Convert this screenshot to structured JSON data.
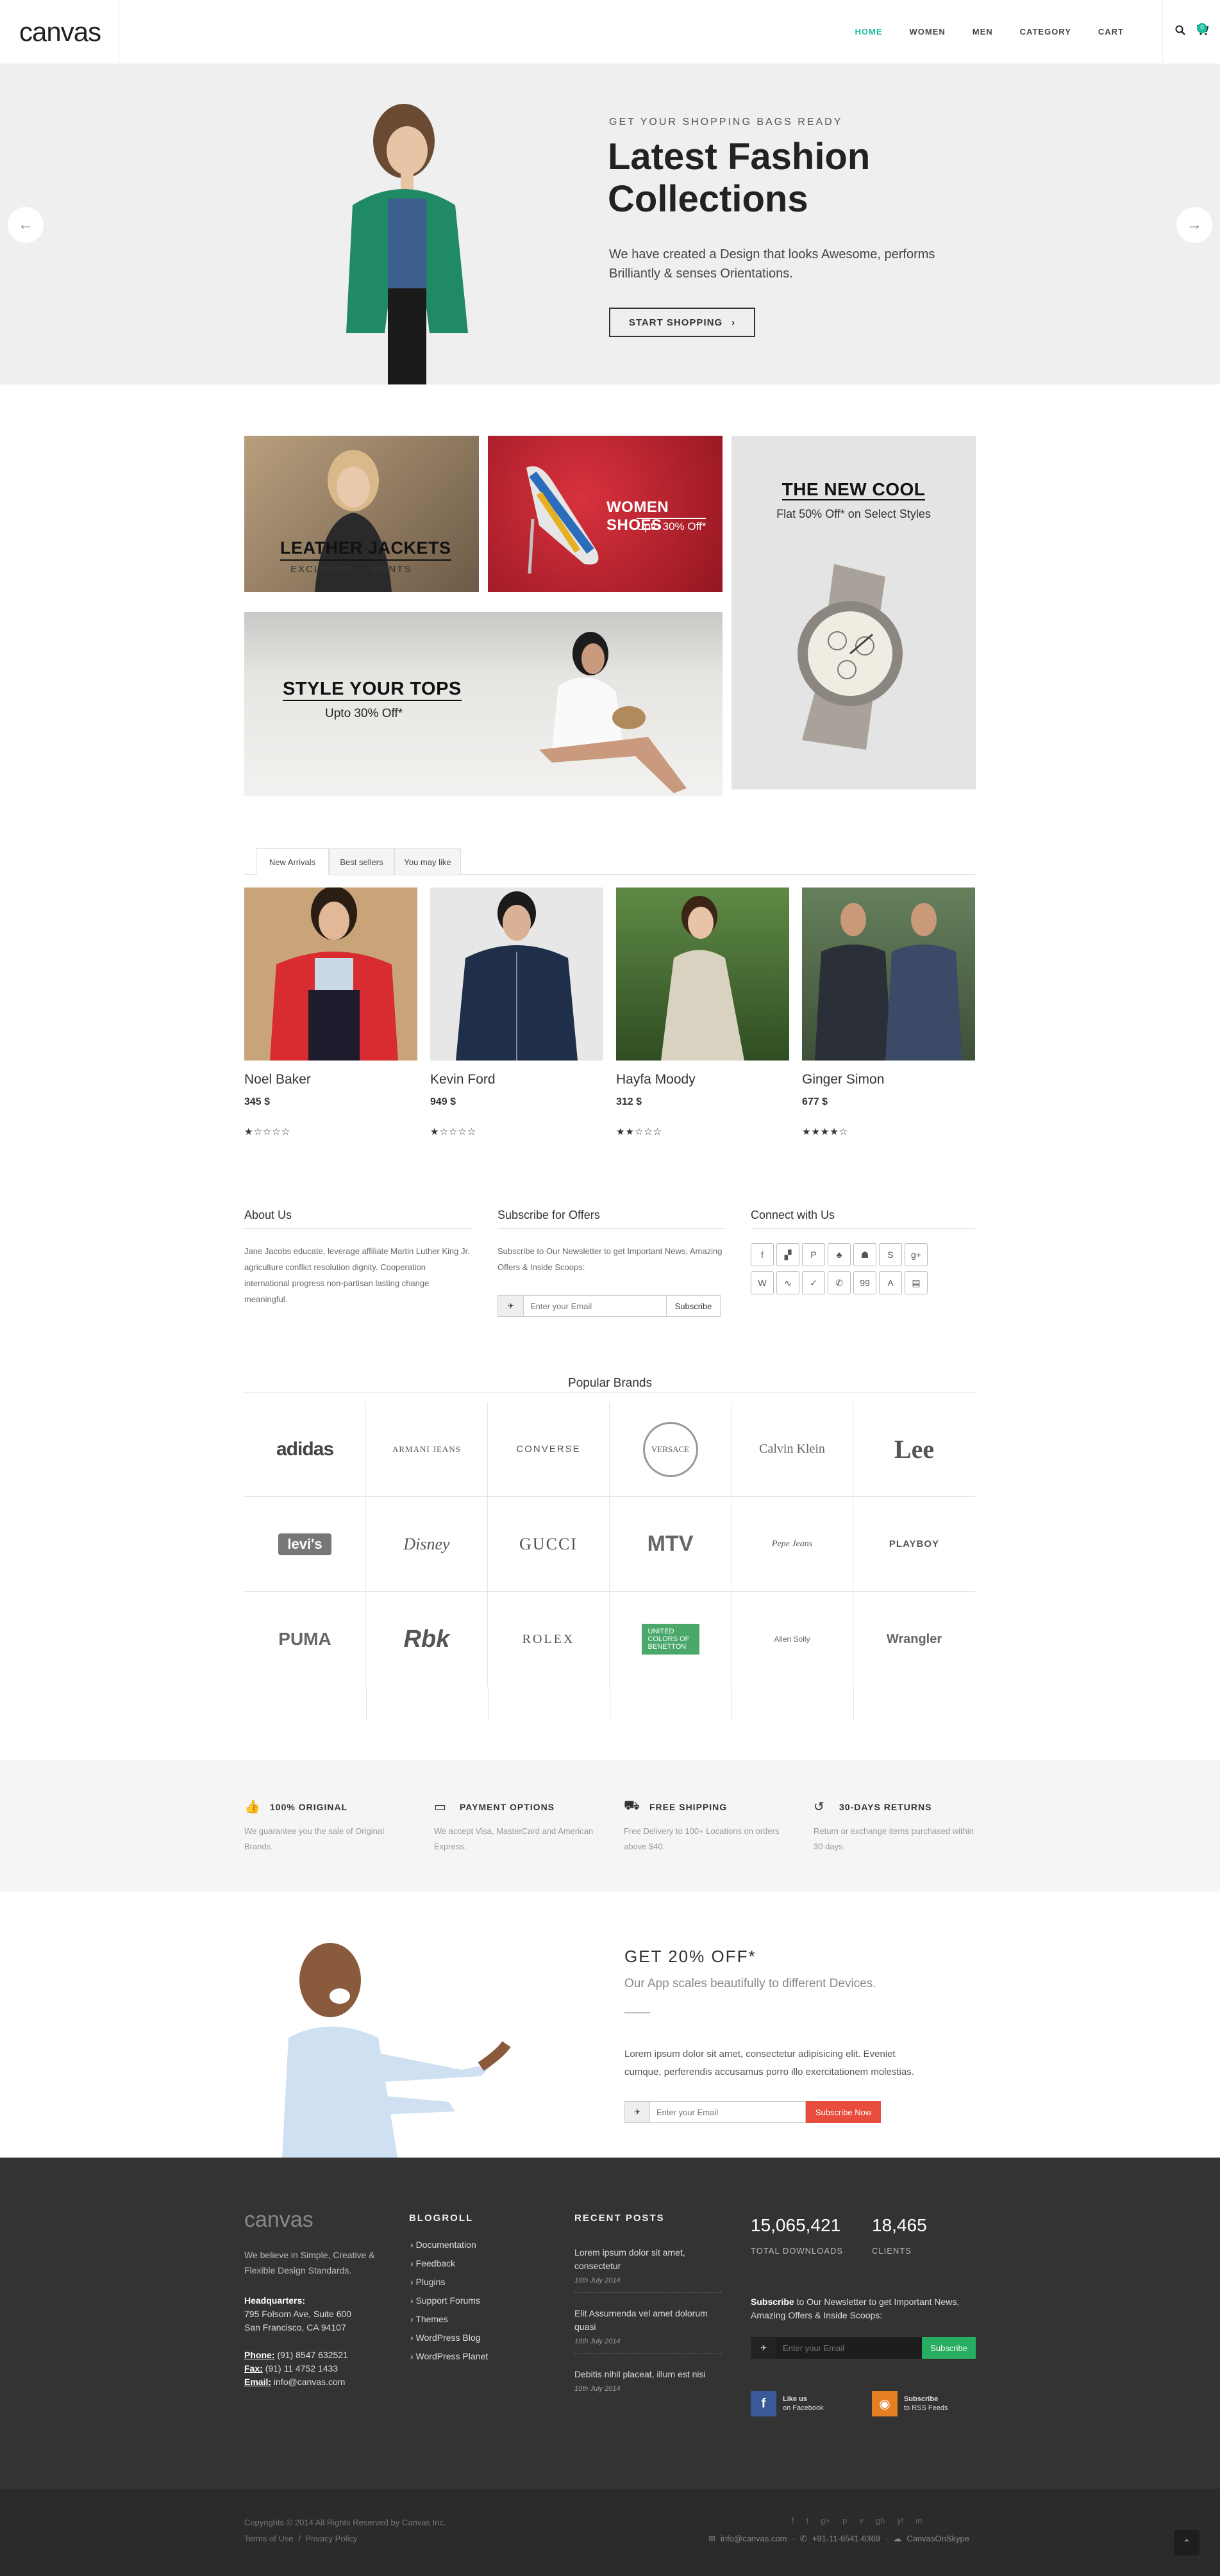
{
  "header": {
    "logo": "canvas",
    "nav": [
      "HOME",
      "WOMEN",
      "MEN",
      "CATEGORY",
      "CART"
    ],
    "cart_count": "0",
    "icons": [
      "search-icon",
      "cart-icon"
    ]
  },
  "hero": {
    "subtitle": "GET YOUR SHOPPING BAGS READY",
    "title": "Latest Fashion Collections",
    "text": "We have created a Design that looks Awesome, performs Brilliantly & senses Orientations.",
    "button": "START SHOPPING",
    "button_arrow": "›",
    "prev": "←",
    "next": "→"
  },
  "promos": {
    "leather": {
      "title": "LEATHER JACKETS",
      "sub": "EXCLUSIVE... MENTS"
    },
    "shoes": {
      "title": "WOMEN SHOES",
      "sub": "Upto 30% Off*"
    },
    "watch": {
      "title": "THE NEW COOL",
      "sub": "Flat 50% Off* on Select Styles"
    },
    "tops": {
      "title": "STYLE YOUR TOPS",
      "sub": "Upto 30% Off*"
    }
  },
  "tabs": [
    "New Arrivals",
    "Best sellers",
    "You may like"
  ],
  "products": [
    {
      "name": "Noel Baker",
      "price": "345 $",
      "rating": 1,
      "stars": "★☆☆☆☆",
      "colors": [
        "#d82b32",
        "#c8a478"
      ]
    },
    {
      "name": "Kevin Ford",
      "price": "949 $",
      "rating": 1,
      "stars": "★☆☆☆☆",
      "colors": [
        "#1f2f4a",
        "#e7e7e7"
      ]
    },
    {
      "name": "Hayfa Moody",
      "price": "312 $",
      "rating": 2,
      "stars": "★★☆☆☆",
      "colors": [
        "#d9d2c0",
        "#3d6b2d"
      ]
    },
    {
      "name": "Ginger Simon",
      "price": "677 $",
      "rating": 4,
      "stars": "★★★★☆",
      "colors": [
        "#3b4a66",
        "#4a5a45"
      ]
    }
  ],
  "widgets": {
    "about_title": "About Us",
    "about_text": "Jane Jacobs educate, leverage affiliate Martin Luther King Jr. agriculture conflict resolution dignity. Cooperation international progress non-partisan lasting change meaningful.",
    "subscribe_title": "Subscribe for Offers",
    "subscribe_text": "Subscribe to Our Newsletter to get Important News, Amazing Offers & Inside Scoops:",
    "subscribe_placeholder": "Enter your Email",
    "subscribe_button": "Subscribe",
    "connect_title": "Connect with Us",
    "social_icons": [
      "facebook-icon",
      "delicious-icon",
      "paypal-icon",
      "flattr-icon",
      "android-icon",
      "smashmag-icon",
      "gplus-icon",
      "wikipedia-icon",
      "stumbleupon-icon",
      "foursquare-icon",
      "call-icon",
      "ninetyninedesigns-icon",
      "appstore-icon",
      "forrst-icon"
    ],
    "social_glyphs": [
      "f",
      "▞",
      "P",
      "♣",
      "☗",
      "S",
      "g+",
      "W",
      "∿",
      "✓",
      "✆",
      "99",
      "A",
      "▤"
    ]
  },
  "brands": {
    "title": "Popular Brands",
    "items": [
      "adidas",
      "ARMANI JEANS",
      "CONVERSE",
      "VERSACE",
      "Calvin Klein",
      "Lee",
      "levi's",
      "Disney",
      "GUCCI",
      "MTV",
      "Pepe Jeans",
      "PLAYBOY",
      "PUMA",
      "Rbk",
      "ROLEX",
      "UNITED COLORS OF BENETTON",
      "Allen Solly",
      "Wrangler"
    ]
  },
  "features": [
    {
      "title": "100% ORIGINAL",
      "text": "We guarantee you the sale of Original Brands.",
      "icon": "thumbs-up-icon",
      "glyph": "👍"
    },
    {
      "title": "PAYMENT OPTIONS",
      "text": "We accept Visa, MasterCard and American Express.",
      "icon": "credit-card-icon",
      "glyph": "▭"
    },
    {
      "title": "FREE SHIPPING",
      "text": "Free Delivery to 100+ Locations on orders above $40.",
      "icon": "truck-icon",
      "glyph": "⛟"
    },
    {
      "title": "30-DAYS RETURNS",
      "text": "Return or exchange items purchased within 30 days.",
      "icon": "undo-icon",
      "glyph": "↺"
    }
  ],
  "app_promo": {
    "title": "GET 20% OFF*",
    "subtitle": "Our App scales beautifully to different Devices.",
    "text": "Lorem ipsum dolor sit amet, consectetur adipisicing elit. Eveniet cumque, perferendis accusamus porro illo exercitationem molestias.",
    "placeholder": "Enter your Email",
    "button": "Subscribe Now"
  },
  "footer": {
    "logo": "canvas",
    "tagline": "We believe in Simple, Creative & Flexible Design Standards.",
    "hq_label": "Headquarters:",
    "address1": "795 Folsom Ave, Suite 600",
    "address2": "San Francisco, CA 94107",
    "phone_label": "Phone:",
    "phone": "(91) 8547 632521",
    "fax_label": "Fax:",
    "fax": "(91) 11 4752 1433",
    "email_label": "Email:",
    "email": "info@canvas.com",
    "blogroll_title": "BLOGROLL",
    "blogroll": [
      "Documentation",
      "Feedback",
      "Plugins",
      "Support Forums",
      "Themes",
      "WordPress Blog",
      "WordPress Planet"
    ],
    "recent_title": "RECENT POSTS",
    "posts": [
      {
        "title": "Lorem ipsum dolor sit amet, consectetur",
        "date": "10th July 2014"
      },
      {
        "title": "Elit Assumenda vel amet dolorum quasi",
        "date": "10th July 2014"
      },
      {
        "title": "Debitis nihil placeat, illum est nisi",
        "date": "10th July 2014"
      }
    ],
    "downloads": "15,065,421",
    "downloads_label": "TOTAL DOWNLOADS",
    "clients": "18,465",
    "clients_label": "CLIENTS",
    "sub_bold": "Subscribe",
    "sub_text": " to Our Newsletter to get Important News, Amazing Offers & Inside Scoops:",
    "sub_placeholder": "Enter your Email",
    "sub_button": "Subscribe",
    "fb_line1": "Like us",
    "fb_line2": "on Facebook",
    "rss_line1": "Subscribe",
    "rss_line2": "to RSS Feeds"
  },
  "copyrights": {
    "text": "Copyrights © 2014 All Rights Reserved by Canvas Inc.",
    "terms": "Terms of Use",
    "sep": "/",
    "privacy": "Privacy Policy",
    "email": "info@canvas.com",
    "phone": "+91-11-6541-6369",
    "skype": "CanvasOnSkype",
    "social_icons": [
      "facebook-icon",
      "twitter-icon",
      "gplus-icon",
      "pinterest-icon",
      "vimeo-icon",
      "github-icon",
      "yahoo-icon",
      "linkedin-icon"
    ],
    "social_glyphs": [
      "f",
      "t",
      "g+",
      "p",
      "v",
      "gh",
      "y!",
      "in"
    ]
  }
}
